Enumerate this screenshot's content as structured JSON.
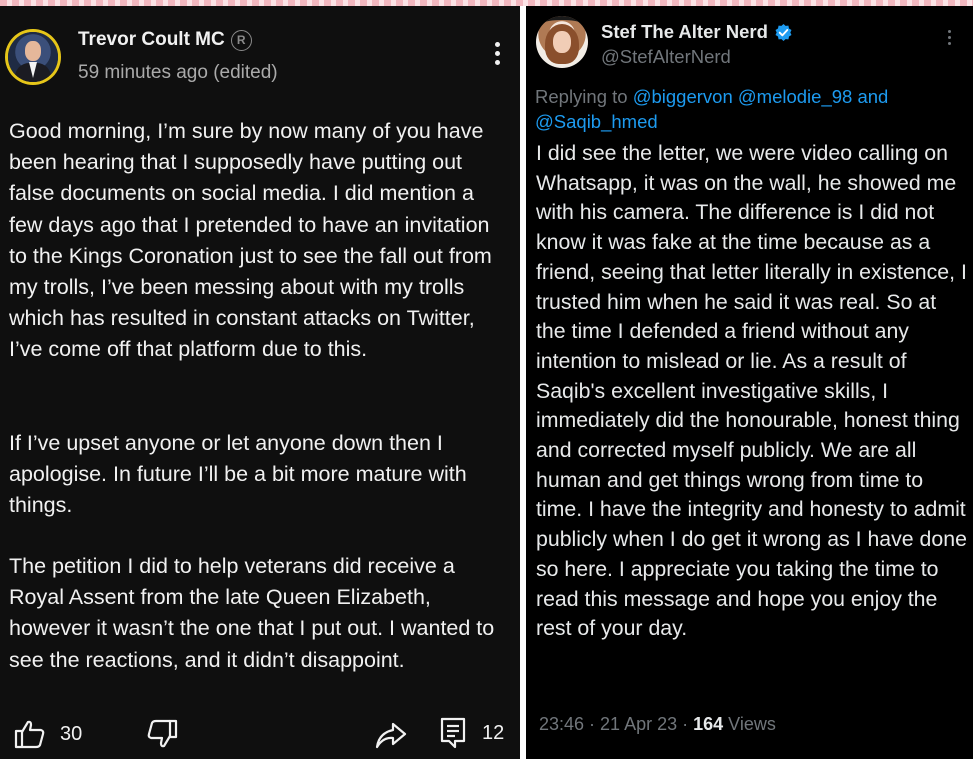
{
  "youtube_post": {
    "author": "Trevor Coult MC",
    "badge_icon": "registered-icon",
    "timestamp": "59 minutes ago (edited)",
    "paragraphs": [
      "Good morning, I’m sure by now many of you have been hearing that I supposedly have putting out false documents on social media. I did mention a few days ago that I pretended to have an invitation to the Kings Coronation just to see the fall out from my trolls, I’ve been messing about with my trolls which has resulted in constant attacks on Twitter, I’ve come off that platform due to this.",
      "If I’ve upset anyone or let anyone down then I apologise. In future I’ll be a bit more mature with things.",
      "The petition I did to help veterans did receive a Royal Assent from the late Queen Elizabeth, however it wasn’t the one that I put out. I wanted to see the reactions, and it didn’t disappoint."
    ],
    "like_count": "30",
    "comment_count": "12"
  },
  "tweet": {
    "display_name": "Stef The Alter Nerd",
    "handle": "@StefAlterNerd",
    "replying_prefix": "Replying to ",
    "mentions": [
      "@biggervon",
      "@melodie_98"
    ],
    "mention_joiner": " and",
    "mention_last": "@Saqib_hmed",
    "body": "I did see the letter, we were video calling on Whatsapp, it was on the wall, he showed me with his camera. The difference is I did not know it was fake at the time because as a friend, seeing that letter literally in existence, I trusted him when he said it was real. So at the time I defended a friend without any intention to mislead or lie. As a result of Saqib's excellent investigative skills, I immediately did the honourable, honest thing and corrected myself publicly. We are all human and get things wrong from time to time. I have the integrity and honesty to admit publicly when I do get it wrong as I have done so here. I appreciate you taking the time to read this message and hope you enjoy the rest of your day.",
    "time": "23:46",
    "date": "21 Apr 23",
    "views_count": "164",
    "views_label": " Views",
    "verified_color": "#1d9bf0"
  },
  "colors": {
    "youtube_bg": "#0f0f0f",
    "twitter_bg": "#000000",
    "mention": "#1d9bf0",
    "muted": "#71767b"
  }
}
